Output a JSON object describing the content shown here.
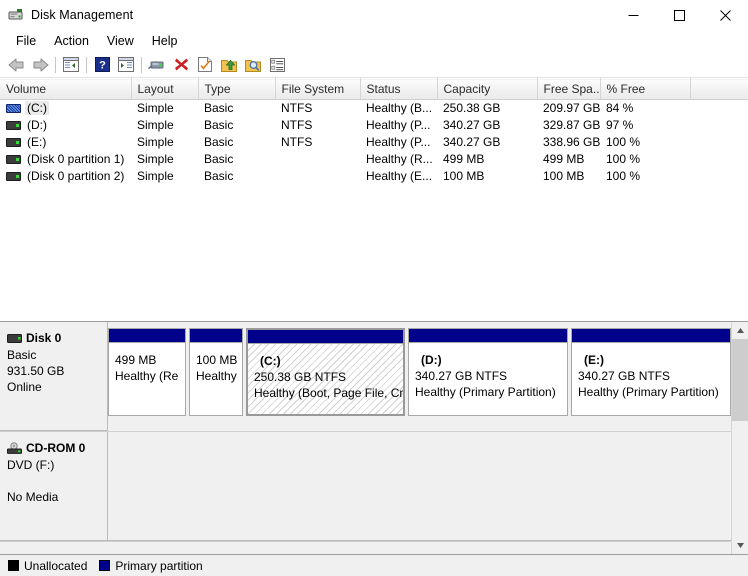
{
  "window": {
    "title": "Disk Management",
    "icon": "disk-management-icon",
    "controls": {
      "minimize": "minimize-icon",
      "maximize": "maximize-icon",
      "close": "close-icon"
    }
  },
  "menubar": {
    "items": [
      {
        "label": "File"
      },
      {
        "label": "Action"
      },
      {
        "label": "View"
      },
      {
        "label": "Help"
      }
    ]
  },
  "toolbar": {
    "buttons": [
      {
        "name": "back-icon"
      },
      {
        "name": "forward-icon"
      },
      {
        "name": "show-hide-console-tree-icon"
      },
      {
        "name": "help-icon"
      },
      {
        "name": "show-hide-action-pane-icon"
      },
      {
        "name": "rescan-disks-icon"
      },
      {
        "name": "delete-icon"
      },
      {
        "name": "properties-icon"
      },
      {
        "name": "extend-volume-icon"
      },
      {
        "name": "search-volume-icon"
      },
      {
        "name": "list-view-icon"
      }
    ]
  },
  "volume_list": {
    "columns": [
      {
        "key": "volume",
        "label": "Volume"
      },
      {
        "key": "layout",
        "label": "Layout"
      },
      {
        "key": "type",
        "label": "Type"
      },
      {
        "key": "file_system",
        "label": "File System"
      },
      {
        "key": "status",
        "label": "Status"
      },
      {
        "key": "capacity",
        "label": "Capacity"
      },
      {
        "key": "free_space",
        "label": "Free Spa..."
      },
      {
        "key": "percent_free",
        "label": "% Free"
      },
      {
        "key": "extra",
        "label": ""
      }
    ],
    "rows": [
      {
        "volume": "(C:)",
        "layout": "Simple",
        "type": "Basic",
        "file_system": "NTFS",
        "status": "Healthy (B...",
        "capacity": "250.38 GB",
        "free_space": "209.97 GB",
        "percent_free": "84 %",
        "selected": true,
        "icon": "drive-icon-selected"
      },
      {
        "volume": "(D:)",
        "layout": "Simple",
        "type": "Basic",
        "file_system": "NTFS",
        "status": "Healthy (P...",
        "capacity": "340.27 GB",
        "free_space": "329.87 GB",
        "percent_free": "97 %",
        "selected": false,
        "icon": "drive-icon"
      },
      {
        "volume": "(E:)",
        "layout": "Simple",
        "type": "Basic",
        "file_system": "NTFS",
        "status": "Healthy (P...",
        "capacity": "340.27 GB",
        "free_space": "338.96 GB",
        "percent_free": "100 %",
        "selected": false,
        "icon": "drive-icon"
      },
      {
        "volume": "(Disk 0 partition 1)",
        "layout": "Simple",
        "type": "Basic",
        "file_system": "",
        "status": "Healthy (R...",
        "capacity": "499 MB",
        "free_space": "499 MB",
        "percent_free": "100 %",
        "selected": false,
        "icon": "drive-icon"
      },
      {
        "volume": "(Disk 0 partition 2)",
        "layout": "Simple",
        "type": "Basic",
        "file_system": "",
        "status": "Healthy (E...",
        "capacity": "100 MB",
        "free_space": "100 MB",
        "percent_free": "100 %",
        "selected": false,
        "icon": "drive-icon"
      }
    ]
  },
  "graphical_view": {
    "disks": [
      {
        "name": "Disk 0",
        "icon": "disk-icon",
        "type": "Basic",
        "size": "931.50 GB",
        "status": "Online",
        "partitions": [
          {
            "drive": "",
            "size_fs": "499 MB",
            "status": "Healthy (Re",
            "width": 78,
            "selected": false
          },
          {
            "drive": "",
            "size_fs": "100 MB",
            "status": "Healthy",
            "width": 54,
            "selected": false
          },
          {
            "drive": "(C:)",
            "size_fs": "250.38 GB NTFS",
            "status": "Healthy (Boot, Page File, Cr",
            "width": 159,
            "selected": true
          },
          {
            "drive": "(D:)",
            "size_fs": "340.27 GB NTFS",
            "status": "Healthy (Primary Partition)",
            "width": 160,
            "selected": false
          },
          {
            "drive": "(E:)",
            "size_fs": "340.27 GB NTFS",
            "status": "Healthy (Primary Partition)",
            "width": 160,
            "selected": false
          }
        ]
      },
      {
        "name": "CD-ROM 0",
        "icon": "cdrom-icon",
        "type": "DVD (F:)",
        "size": "",
        "status": "No Media",
        "partitions": []
      }
    ],
    "scrollbar": {
      "up_arrow": "scroll-up-icon",
      "down_arrow": "scroll-down-icon"
    }
  },
  "legend": {
    "entries": [
      {
        "label": "Unallocated",
        "color": "#000000"
      },
      {
        "label": "Primary partition",
        "color": "#00008b"
      }
    ]
  }
}
